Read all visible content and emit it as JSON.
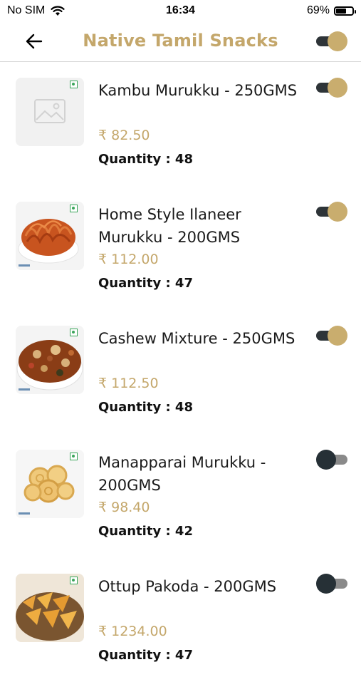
{
  "status": {
    "carrier": "No SIM",
    "time": "16:34",
    "battery": "69%",
    "battery_level": 0.69
  },
  "header": {
    "title": "Native Tamil Snacks",
    "toggle_on": true
  },
  "products": [
    {
      "name": "Kambu Murukku - 250GMS",
      "price": "₹ 82.50",
      "quantity": "Quantity : 48",
      "enabled": true,
      "image": "placeholder-image-icon"
    },
    {
      "name": "Home Style Ilaneer Murukku - 200GMS",
      "price": "₹ 112.00",
      "quantity": "Quantity : 47",
      "enabled": true,
      "image": "murukku-bowl-photo"
    },
    {
      "name": "Cashew Mixture - 250GMS",
      "price": "₹ 112.50",
      "quantity": "Quantity : 48",
      "enabled": true,
      "image": "mixture-bowl-photo"
    },
    {
      "name": "Manapparai Murukku - 200GMS",
      "price": "₹ 98.40",
      "quantity": "Quantity : 42",
      "enabled": false,
      "image": "manapparai-murukku-photo"
    },
    {
      "name": "Ottup Pakoda - 200GMS",
      "price": "₹ 1234.00",
      "quantity": "Quantity : 47",
      "enabled": false,
      "image": "pakoda-basket-photo"
    }
  ],
  "colors": {
    "accent": "#c4a76b",
    "toggle_dark": "#2e3438",
    "veg_green": "#3aa55a"
  }
}
